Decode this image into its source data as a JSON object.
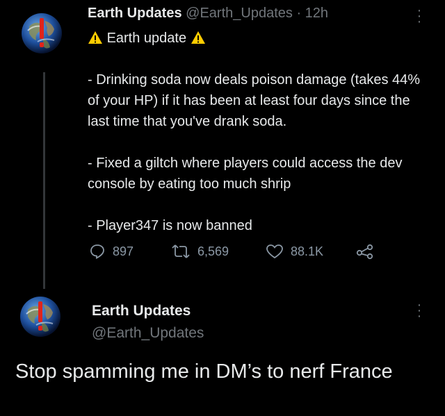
{
  "tweet1": {
    "author_name": "Earth Updates",
    "author_handle": "@Earth_Updates",
    "separator": " · ",
    "time": "12h",
    "title": "Earth update",
    "lines": [
      "- Drinking soda now deals poison damage (takes 44% of your HP) if it has been at least four days since the last time that you've drank soda.",
      "- Fixed a giltch where players could access the dev console by eating too much shrip",
      "- Player347 is now banned"
    ],
    "replies": "897",
    "retweets": "6,569",
    "likes": "88.1K"
  },
  "tweet2": {
    "author_name": "Earth Updates",
    "author_handle": "@Earth_Updates",
    "text": "Stop spamming me in DM’s to nerf France"
  },
  "icons": {
    "avatar": "earth-globe-with-red-exclamation",
    "warning": "warning-triangle-icon",
    "reply": "reply-bubble-icon",
    "retweet": "retweet-icon",
    "like": "heart-icon",
    "share": "share-icon",
    "more": "more-options-icon"
  },
  "colors": {
    "background": "#000000",
    "text": "#e7e9ea",
    "secondary": "#71767b",
    "warning": "#ffcc00",
    "exclamation": "#e0241b"
  }
}
